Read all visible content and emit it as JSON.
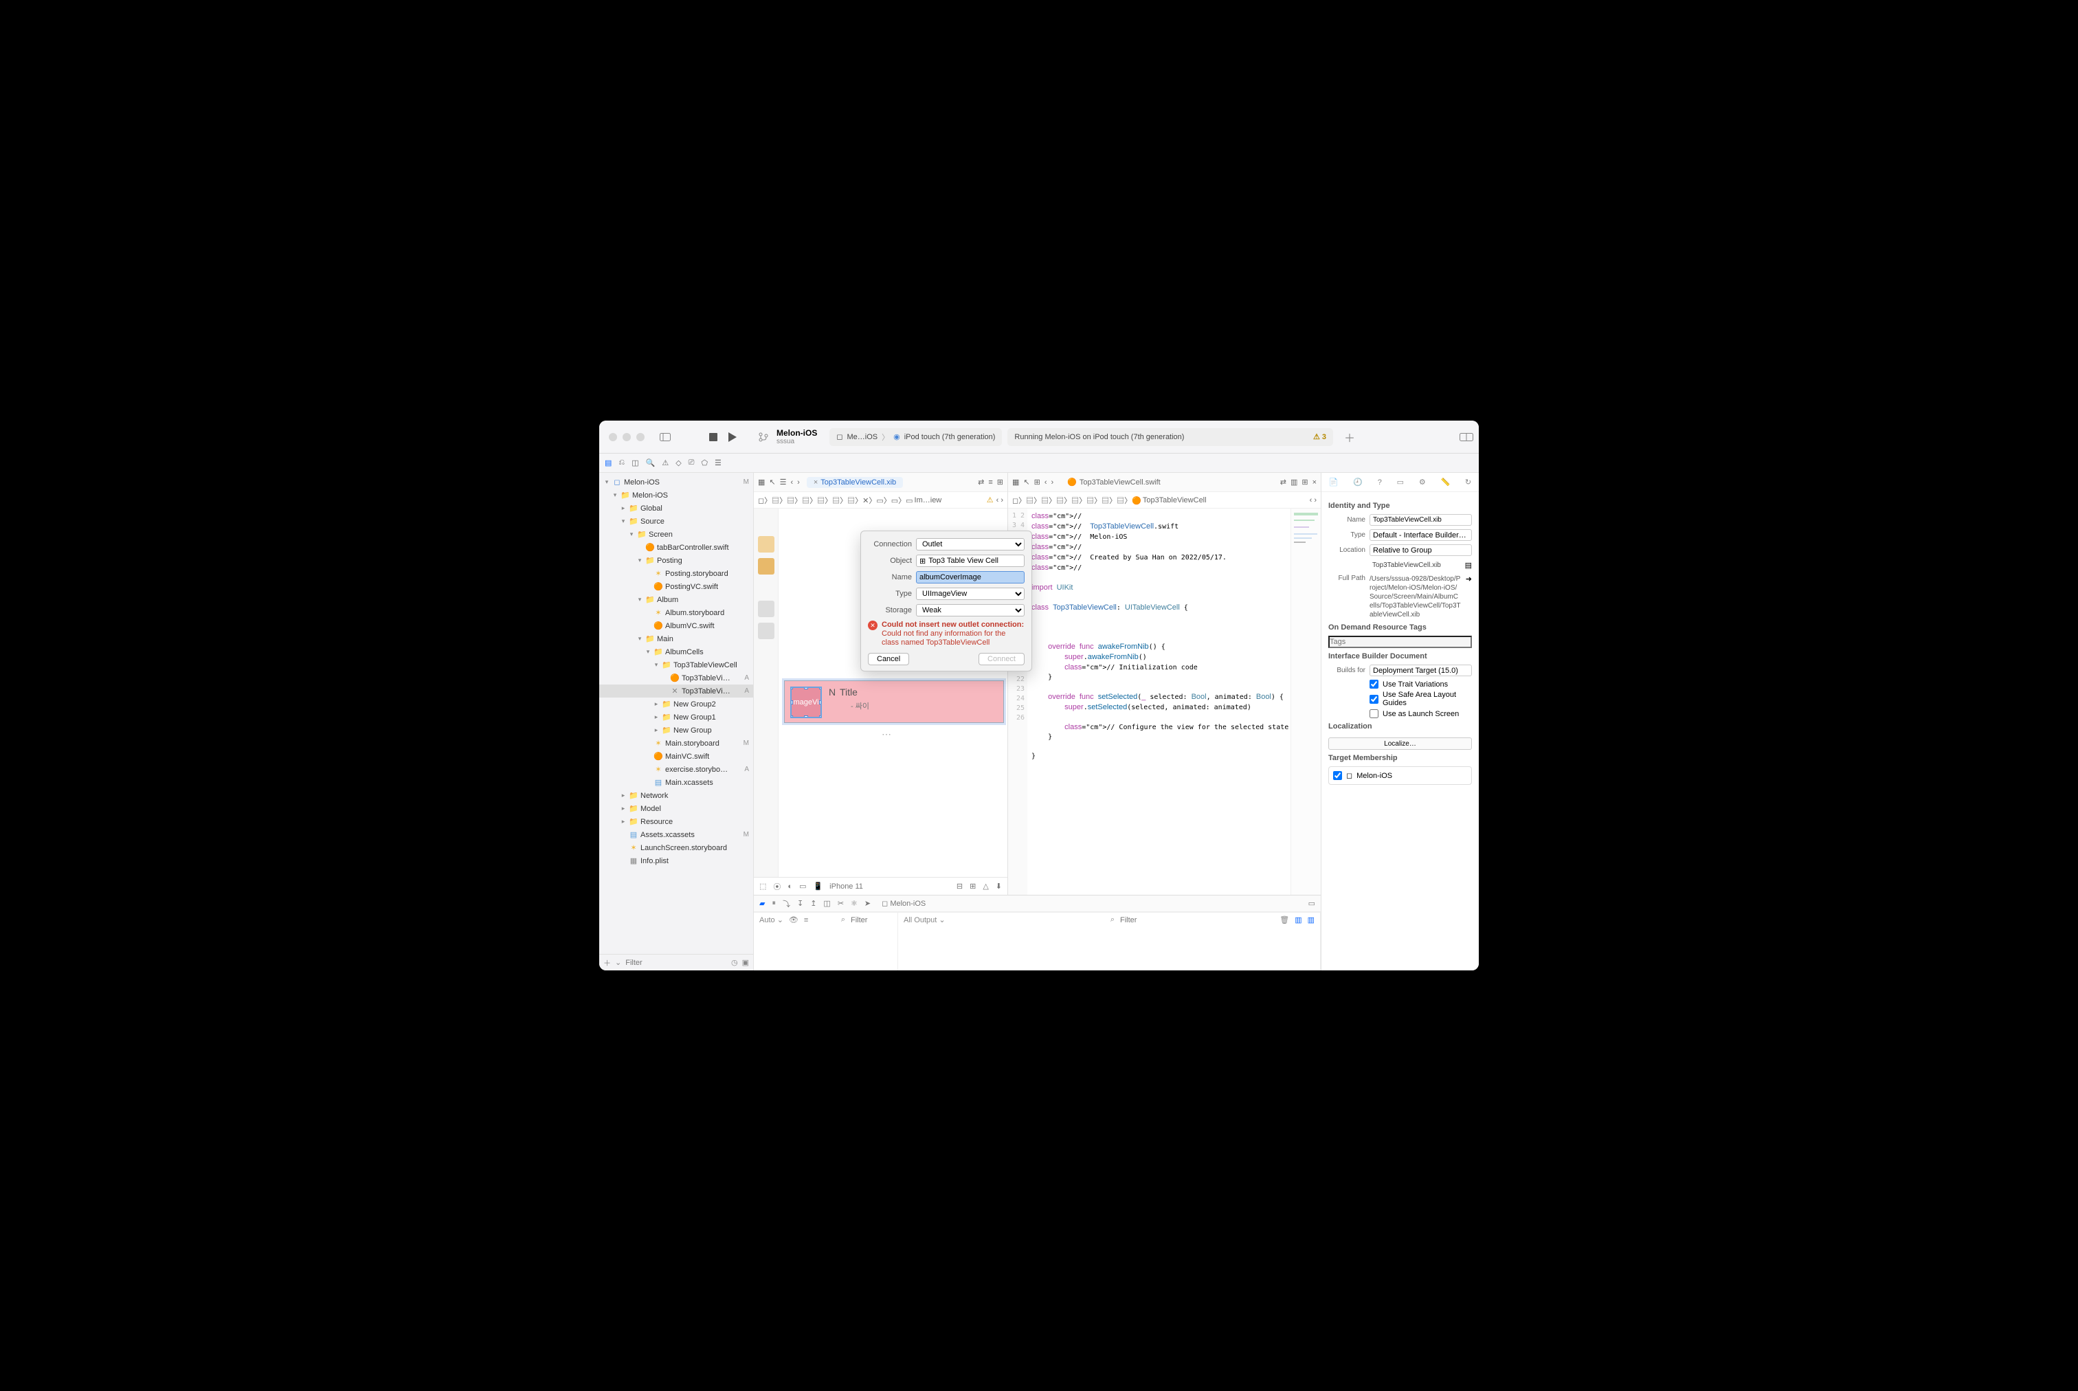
{
  "titlebar": {
    "project": "Melon-iOS",
    "branch": "sssua",
    "scheme_left": "Me…iOS",
    "scheme_device": "iPod touch (7th generation)",
    "status": "Running Melon-iOS on iPod touch (7th generation)",
    "warnings": "3"
  },
  "navigator": {
    "filter_placeholder": "Filter",
    "tree": [
      {
        "d": 0,
        "icon": "proj",
        "label": "Melon-iOS",
        "badge": "M",
        "open": true
      },
      {
        "d": 1,
        "icon": "folder",
        "label": "Melon-iOS",
        "open": true
      },
      {
        "d": 2,
        "icon": "folder",
        "label": "Global"
      },
      {
        "d": 2,
        "icon": "folder",
        "label": "Source",
        "open": true
      },
      {
        "d": 3,
        "icon": "folder",
        "label": "Screen",
        "open": true
      },
      {
        "d": 4,
        "icon": "swift",
        "label": "tabBarController.swift"
      },
      {
        "d": 4,
        "icon": "folder",
        "label": "Posting",
        "open": true
      },
      {
        "d": 5,
        "icon": "story",
        "label": "Posting.storyboard"
      },
      {
        "d": 5,
        "icon": "swift",
        "label": "PostingVC.swift"
      },
      {
        "d": 4,
        "icon": "folder",
        "label": "Album",
        "open": true
      },
      {
        "d": 5,
        "icon": "story",
        "label": "Album.storyboard"
      },
      {
        "d": 5,
        "icon": "swift",
        "label": "AlbumVC.swift"
      },
      {
        "d": 4,
        "icon": "folder",
        "label": "Main",
        "open": true
      },
      {
        "d": 5,
        "icon": "folder",
        "label": "AlbumCells",
        "open": true
      },
      {
        "d": 6,
        "icon": "folder",
        "label": "Top3TableViewCell",
        "open": true
      },
      {
        "d": 7,
        "icon": "swift",
        "label": "Top3TableVi…",
        "badge": "A"
      },
      {
        "d": 7,
        "icon": "xib",
        "label": "Top3TableVi…",
        "badge": "A",
        "sel": true
      },
      {
        "d": 6,
        "icon": "folder",
        "label": "New Group2"
      },
      {
        "d": 6,
        "icon": "folder",
        "label": "New Group1"
      },
      {
        "d": 6,
        "icon": "folder",
        "label": "New Group"
      },
      {
        "d": 5,
        "icon": "story",
        "label": "Main.storyboard",
        "badge": "M"
      },
      {
        "d": 5,
        "icon": "swift",
        "label": "MainVC.swift"
      },
      {
        "d": 5,
        "icon": "story",
        "label": "exercise.storybo…",
        "badge": "A"
      },
      {
        "d": 5,
        "icon": "assets",
        "label": "Main.xcassets"
      },
      {
        "d": 2,
        "icon": "folder",
        "label": "Network"
      },
      {
        "d": 2,
        "icon": "folder",
        "label": "Model"
      },
      {
        "d": 2,
        "icon": "folder",
        "label": "Resource"
      },
      {
        "d": 2,
        "icon": "assets",
        "label": "Assets.xcassets",
        "badge": "M"
      },
      {
        "d": 2,
        "icon": "story",
        "label": "LaunchScreen.storyboard"
      },
      {
        "d": 2,
        "icon": "plist",
        "label": "Info.plist"
      }
    ]
  },
  "editor": {
    "left_tab": "Top3TableViewCell.xib",
    "right_tab": "Top3TableViewCell.swift",
    "left_crumb_last": "Im…iew",
    "right_crumb_last": "Top3TableViewCell",
    "ib_device": "iPhone 11",
    "cell_n": "N",
    "cell_title": "Title",
    "cell_sub": "- 싸이",
    "cell_img_label": "mageVi"
  },
  "popover": {
    "connection_label": "Connection",
    "connection_value": "Outlet",
    "object_label": "Object",
    "object_value": "Top3 Table View Cell",
    "name_label": "Name",
    "name_value": "albumCoverImage",
    "type_label": "Type",
    "type_value": "UIImageView",
    "storage_label": "Storage",
    "storage_value": "Weak",
    "error_bold": "Could not insert new outlet connection:",
    "error_rest": " Could not find any information for the class named Top3TableViewCell",
    "cancel": "Cancel",
    "connect": "Connect"
  },
  "code": {
    "lines": [
      "//",
      "//  Top3TableViewCell.swift",
      "//  Melon-iOS",
      "//",
      "//  Created by Sua Han on 2022/05/17.",
      "//",
      "",
      "import UIKit",
      "",
      "class Top3TableViewCell: UITableViewCell {",
      "",
      "",
      "",
      "    override func awakeFromNib() {",
      "        super.awakeFromNib()",
      "        // Initialization code",
      "    }",
      "",
      "    override func setSelected(_ selected: Bool, animated: Bool) {",
      "        super.setSelected(selected, animated: animated)",
      "",
      "        // Configure the view for the selected state",
      "    }",
      "",
      "}",
      ""
    ]
  },
  "inspector": {
    "identity_title": "Identity and Type",
    "name_label": "Name",
    "name_value": "Top3TableViewCell.xib",
    "type_label": "Type",
    "type_value": "Default - Interface Builder…",
    "location_label": "Location",
    "location_value": "Relative to Group",
    "location_file": "Top3TableViewCell.xib",
    "fullpath_label": "Full Path",
    "fullpath_value": "/Users/sssua-0928/Desktop/Project/Melon-iOS/Melon-iOS/Source/Screen/Main/AlbumCells/Top3TableViewCell/Top3TableViewCell.xib",
    "ondemand_title": "On Demand Resource Tags",
    "tags_placeholder": "Tags",
    "ibdoc_title": "Interface Builder Document",
    "builds_label": "Builds for",
    "builds_value": "Deployment Target (15.0)",
    "check_trait": "Use Trait Variations",
    "check_safe": "Use Safe Area Layout Guides",
    "check_launch": "Use as Launch Screen",
    "localization_title": "Localization",
    "localize_btn": "Localize…",
    "target_title": "Target Membership",
    "target_name": "Melon-iOS"
  },
  "debug": {
    "scheme": "Melon-iOS",
    "auto": "Auto",
    "all_output": "All Output",
    "filter_placeholder": "Filter"
  }
}
